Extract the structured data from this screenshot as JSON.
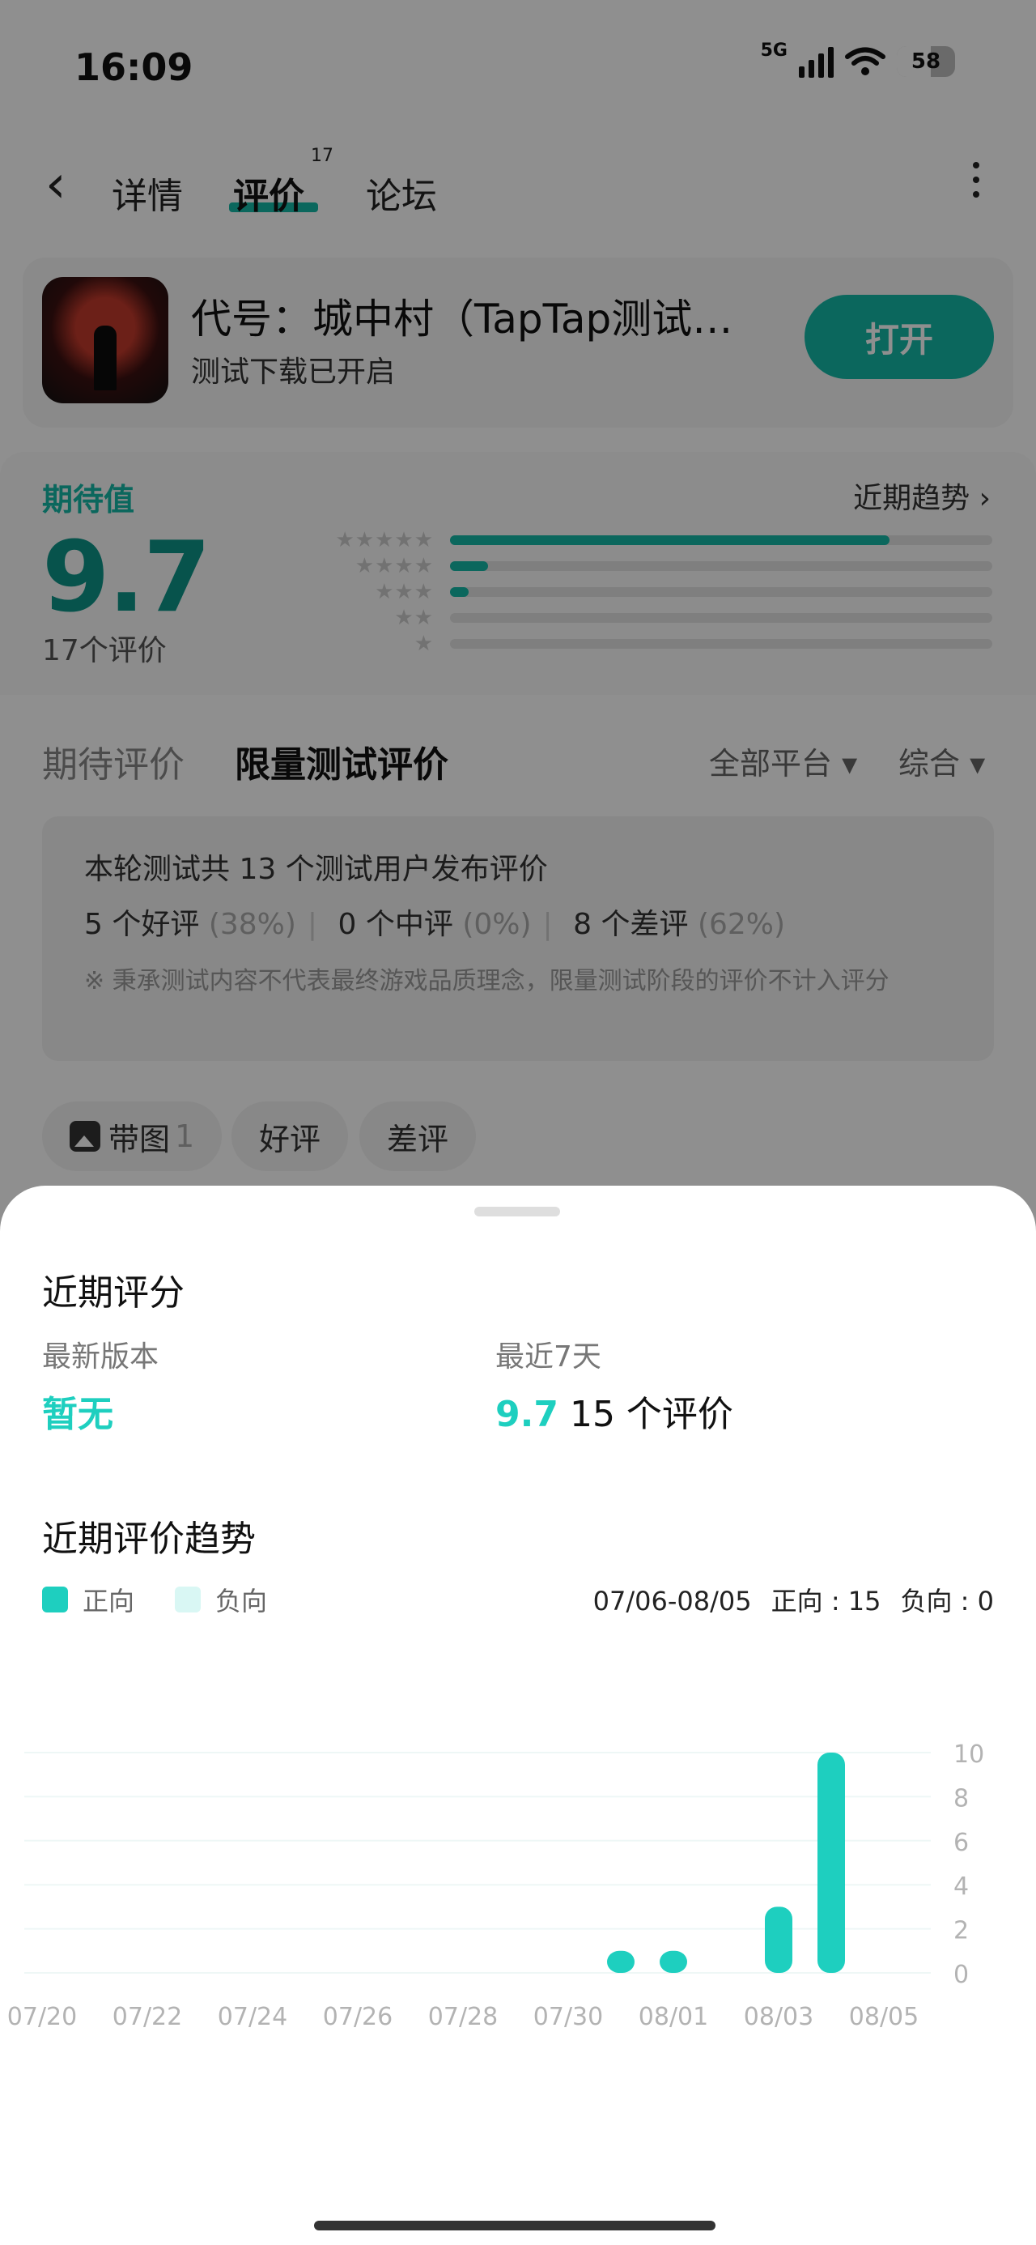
{
  "status": {
    "time": "16:09",
    "network": "5G",
    "battery": "58"
  },
  "nav": {
    "tabs": [
      {
        "label": "详情"
      },
      {
        "label": "评价",
        "count": "17"
      },
      {
        "label": "论坛"
      }
    ]
  },
  "app": {
    "title": "代号：城中村（TapTap测试…",
    "subtitle": "测试下载已开启",
    "open_label": "打开"
  },
  "rating": {
    "label": "期待值",
    "trend_label": "近期趋势",
    "score": "9.7",
    "count_text": "17个评价",
    "distribution": [
      {
        "stars": "★★★★★",
        "fraction": 0.81
      },
      {
        "stars": "★★★★",
        "fraction": 0.07
      },
      {
        "stars": "★★★",
        "fraction": 0.035
      },
      {
        "stars": "★★",
        "fraction": 0.0
      },
      {
        "stars": "★",
        "fraction": 0.0
      }
    ]
  },
  "reviews": {
    "tabs": [
      "期待评价",
      "限量测试评价"
    ],
    "platform_filter": "全部平台",
    "sort_filter": "综合",
    "summary_line1": "本轮测试共 13 个测试用户发布评价",
    "good": "5 个好评",
    "good_pct": "(38%)",
    "mid": "0 个中评",
    "mid_pct": "(0%)",
    "bad": "8 个差评",
    "bad_pct": "(62%)",
    "note": "※ 秉承测试内容不代表最终游戏品质理念，限量测试阶段的评价不计入评分",
    "chips": [
      {
        "label": "带图",
        "count": "1"
      },
      {
        "label": "好评"
      },
      {
        "label": "差评"
      }
    ]
  },
  "sheet": {
    "title": "近期评分",
    "latest_version_label": "最新版本",
    "latest_version_value": "暂无",
    "recent_label": "最近7天",
    "recent_score": "9.7",
    "recent_count": "15 个评价",
    "trend_title": "近期评价趋势",
    "legend_positive": "正向",
    "legend_negative": "负向",
    "range": "07/06-08/05",
    "positive_total": "正向 : 15",
    "negative_total": "负向 : 0",
    "colors": {
      "positive": "#1ecfbf",
      "negative": "#d9f7f4"
    }
  },
  "chart_data": {
    "type": "bar",
    "x_tick_labels": [
      "07/20",
      "07/22",
      "07/24",
      "07/26",
      "07/28",
      "07/30",
      "08/01",
      "08/03",
      "08/05"
    ],
    "y_ticks": [
      0,
      2,
      4,
      6,
      8,
      10
    ],
    "ylim": [
      0,
      10
    ],
    "series": [
      {
        "name": "正向",
        "points": [
          {
            "x": "07/31",
            "value": 1
          },
          {
            "x": "08/01",
            "value": 1
          },
          {
            "x": "08/03",
            "value": 3
          },
          {
            "x": "08/04",
            "value": 10
          }
        ]
      },
      {
        "name": "负向",
        "points": []
      }
    ],
    "grid": true
  }
}
